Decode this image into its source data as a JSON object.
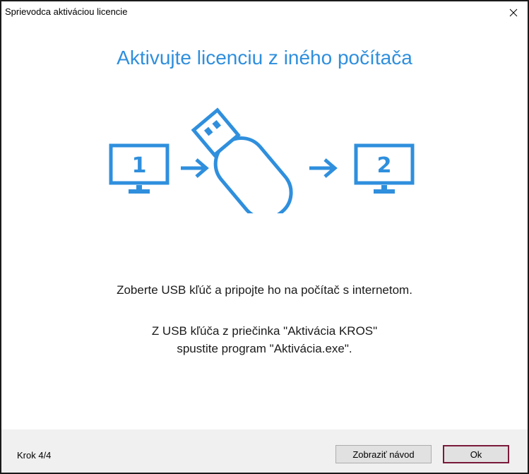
{
  "window": {
    "title": "Sprievodca aktiváciou licencie",
    "close_icon": "close-icon"
  },
  "content": {
    "heading": "Aktivujte licenciu z iného počítača",
    "illustration": {
      "computer_1_label": "1",
      "computer_2_label": "2",
      "icons": [
        "monitor-icon",
        "arrow-right-icon",
        "usb-drive-icon",
        "arrow-right-icon",
        "monitor-icon"
      ],
      "color": "#2f8fdd"
    },
    "message_1": "Zoberte USB kľúč a pripojte ho na počítač s internetom.",
    "message_2_line_1": "Z USB kľúča z priečinka \"Aktivácia KROS\"",
    "message_2_line_2": "spustite program \"Aktivácia.exe\"."
  },
  "footer": {
    "step": "Krok 4/4",
    "guide_button": "Zobraziť návod",
    "ok_button": "Ok"
  },
  "colors": {
    "accent": "#2f8fdd",
    "footer_bg": "#f0f0f0",
    "ok_focus_border": "#7a1a3a"
  }
}
